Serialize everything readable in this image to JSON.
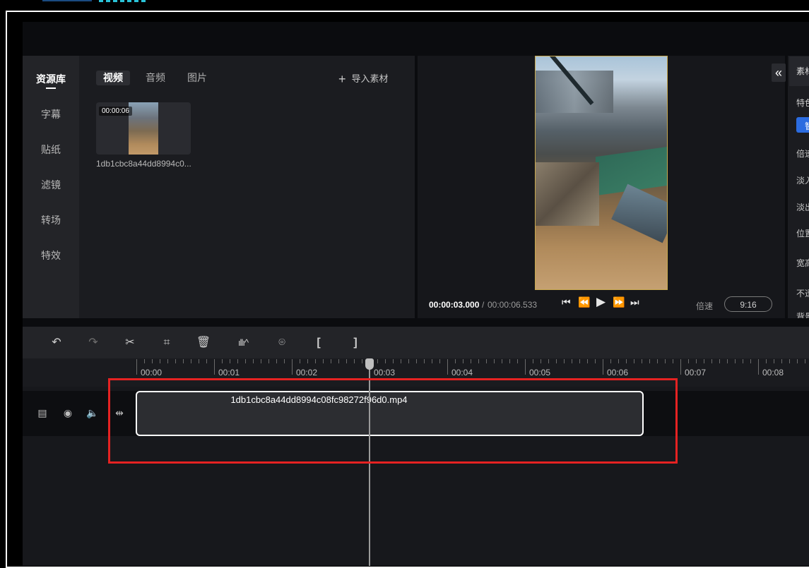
{
  "nav": {
    "items": [
      {
        "label": "资源库",
        "active": true
      },
      {
        "label": "字幕"
      },
      {
        "label": "贴纸"
      },
      {
        "label": "滤镜"
      },
      {
        "label": "转场"
      },
      {
        "label": "特效"
      }
    ]
  },
  "library": {
    "tabs": [
      "视频",
      "音频",
      "图片"
    ],
    "import_label": "导入素材",
    "import_icon": "plus-icon",
    "item": {
      "duration": "00:00:06",
      "name": "1db1cbc8a44dd8994c0..."
    }
  },
  "preview": {
    "current_time": "00:00:03.000",
    "separator": "/",
    "total_time": "00:00:06.533",
    "speed_label": "倍速",
    "ratio_label": "9:16"
  },
  "right_panel": {
    "tab_label": "素材",
    "items": [
      "特色",
      "智",
      "倍速",
      "淡入",
      "淡出",
      "位置",
      "宽高",
      "不透",
      "背景"
    ]
  },
  "toolbar": {
    "icons": [
      "undo-icon",
      "redo-icon",
      "cut-icon",
      "crop-icon",
      "delete-icon",
      "audio-wave-icon",
      "marker-icon",
      "mark-in-icon",
      "mark-out-icon"
    ]
  },
  "timeline": {
    "tick_labels": [
      "00:00",
      "00:01",
      "00:02",
      "00:03",
      "00:04",
      "00:05",
      "00:06",
      "00:07",
      "00:08"
    ],
    "clip_name": "1db1cbc8a44dd8994c08fc98272f96d0.mp4",
    "track_icons": [
      "film-icon",
      "eye-icon",
      "volume-icon",
      "split-icon"
    ]
  },
  "colors": {
    "accent": "#2b6ce0",
    "highlight_box": "#e52222",
    "clip_border": "#ffffff"
  }
}
